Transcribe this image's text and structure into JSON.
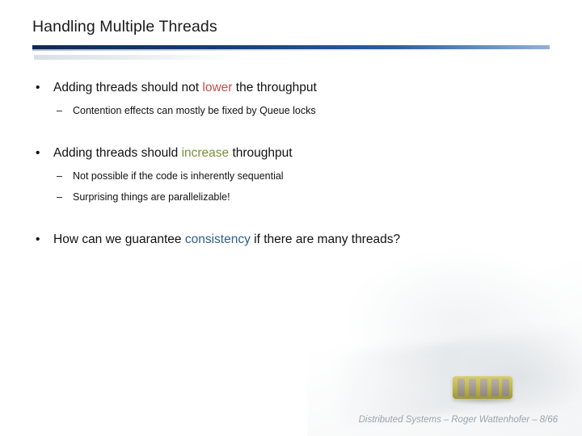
{
  "slide": {
    "title": "Handling Multiple Threads",
    "bullets": [
      {
        "level": 1,
        "marker": "•",
        "segments": [
          {
            "text": "Adding threads should not ",
            "style": "normal"
          },
          {
            "text": "lower",
            "style": "red"
          },
          {
            "text": " the throughput",
            "style": "normal"
          }
        ]
      },
      {
        "level": 2,
        "marker": "–",
        "segments": [
          {
            "text": "Contention effects can mostly be fixed by Queue locks",
            "style": "normal"
          }
        ]
      },
      {
        "level": 1,
        "marker": "•",
        "segments": [
          {
            "text": "Adding threads should ",
            "style": "normal"
          },
          {
            "text": "increase",
            "style": "green"
          },
          {
            "text": " throughput",
            "style": "normal"
          }
        ]
      },
      {
        "level": 2,
        "marker": "–",
        "segments": [
          {
            "text": "Not possible if the code is inherently sequential",
            "style": "normal"
          }
        ]
      },
      {
        "level": 2,
        "marker": "–",
        "segments": [
          {
            "text": "Surprising things are parallelizable!",
            "style": "normal"
          }
        ]
      },
      {
        "level": 1,
        "marker": "•",
        "segments": [
          {
            "text": "How can we guarantee ",
            "style": "normal"
          },
          {
            "text": "consistency",
            "style": "blue"
          },
          {
            "text": " if there are many threads?",
            "style": "normal"
          }
        ]
      }
    ],
    "footer": {
      "course": "Distributed Systems",
      "dash1": "–",
      "author": "Roger Wattenhofer",
      "dash2": "–",
      "page": "8/66"
    },
    "colors": {
      "rule_dark": "#0e2a55",
      "rule_light": "#93b1d4",
      "highlight_red": "#c0504d",
      "highlight_green": "#77933c",
      "highlight_blue": "#2e5f8a",
      "footer_text": "#9aa4ad"
    }
  }
}
